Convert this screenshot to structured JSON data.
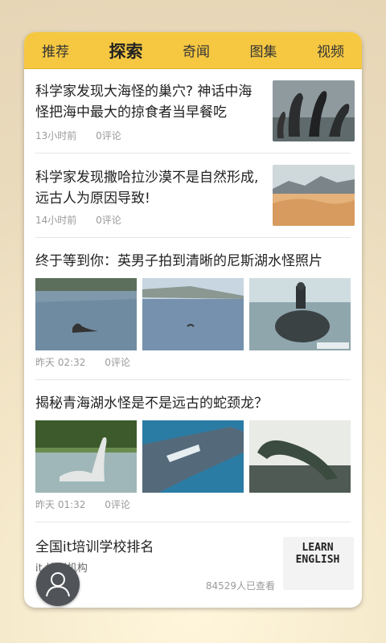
{
  "tabs": [
    {
      "label": "推荐",
      "active": false
    },
    {
      "label": "探索",
      "active": true
    },
    {
      "label": "奇闻",
      "active": false
    },
    {
      "label": "图集",
      "active": false
    },
    {
      "label": "视频",
      "active": false
    }
  ],
  "articles": [
    {
      "title": "科学家发现大海怪的巢穴? 神话中海怪把海中最大的掠食者当早餐吃",
      "time": "13小时前",
      "comments": "0评论"
    },
    {
      "title": "科学家发现撒哈拉沙漠不是自然形成, 远古人为原因导致!",
      "time": "14小时前",
      "comments": "0评论"
    },
    {
      "title": "终于等到你：英男子拍到清晰的尼斯湖水怪照片",
      "time": "昨天 02:32",
      "comments": "0评论"
    },
    {
      "title": "揭秘青海湖水怪是不是远古的蛇颈龙？",
      "time": "昨天 01:32",
      "comments": "0评论"
    }
  ],
  "ad": {
    "title": "全国it培训学校排名",
    "source": "it 培训机构",
    "views": "84529人已查看",
    "thumb_text": "LEARN ENGLISH"
  },
  "colors": {
    "tabbar": "#f6c842",
    "card": "#ffffff",
    "meta": "#9a9a9a"
  },
  "icons": {
    "avatar": "person-icon"
  }
}
